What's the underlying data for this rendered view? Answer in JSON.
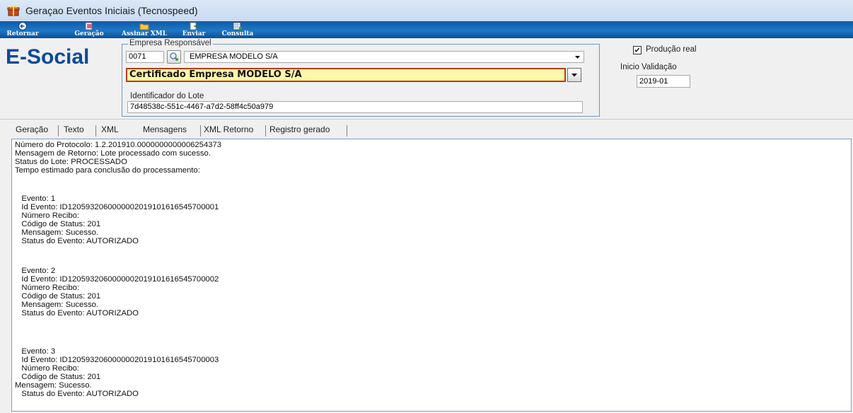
{
  "window": {
    "title": "Geraçao Eventos Iniciais (Tecnospeed)"
  },
  "toolbar": {
    "buttons": [
      {
        "label": "Retornar",
        "icon": "back-arrow-icon"
      },
      {
        "label": "Geração",
        "icon": "generate-icon"
      },
      {
        "label": "Assinar XML",
        "icon": "folder-sign-icon"
      },
      {
        "label": "Enviar",
        "icon": "send-icon"
      },
      {
        "label": "Consulta",
        "icon": "query-icon"
      }
    ]
  },
  "header": {
    "logo_text": "E-Social",
    "empresa_legend": "Empresa Responsável",
    "empresa_code": "0071",
    "empresa_name": "EMPRESA MODELO S/A",
    "certificado": "Certificado Empresa MODELO S/A",
    "lote_label": "Identificador do Lote",
    "lote_value": "7d48538c-551c-4467-a7d2-58ff4c50a979",
    "producao_label": "Produção real",
    "producao_checked": true,
    "inicio_label": "Inicio Validação",
    "inicio_value": "2019-01"
  },
  "tabs": [
    "Geração",
    "Texto",
    "XML",
    "Mensagens",
    "XML Retorno",
    "Registro gerado"
  ],
  "active_tab": "Mensagens",
  "messages": [
    "Número do Protocolo: 1.2.201910.0000000000006254373",
    "Mensagem de Retorno: Lote processado com sucesso.",
    "Status do Lote: PROCESSADO",
    "Tempo estimado para conclusão do processamento:",
    "   Evento: 1",
    "   Id Evento: ID1205932060000002019101616545700001",
    "   Número Recibo:",
    "   Código de Status: 201",
    "   Mensagem: Sucesso.",
    "   Status do Evento: AUTORIZADO",
    "   Evento: 2",
    "   Id Evento: ID1205932060000002019101616545700002",
    "   Número Recibo:",
    "   Código de Status: 201",
    "   Mensagem: Sucesso.",
    "   Status do Evento: AUTORIZADO",
    "   Evento: 3",
    "   Id Evento: ID1205932060000002019101616545700003",
    "   Número Recibo:",
    "   Código de Status: 201",
    "Mensagem: Sucesso.",
    "   Status do Evento: AUTORIZADO"
  ],
  "colors": {
    "toolbar": "#1d78c9",
    "logo": "#0c4a9a",
    "certificate_bg": "#fff7a8",
    "certificate_border": "#b53b15"
  }
}
